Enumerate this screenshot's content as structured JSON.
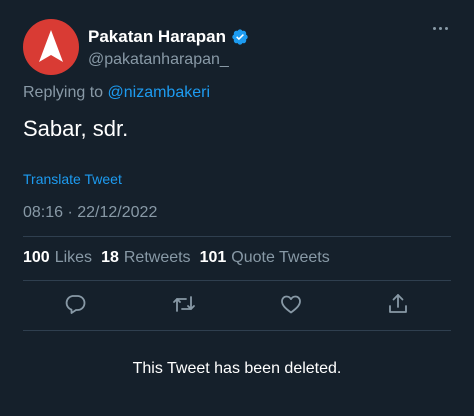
{
  "author": {
    "name": "Pakatan Harapan",
    "handle": "@pakatanharapan_",
    "avatar_icon": "ph-logo-icon",
    "avatar_color": "#d93b34"
  },
  "reply": {
    "prefix": "Replying to",
    "mention": "@nizambakeri"
  },
  "tweet": {
    "text": "Sabar, sdr.",
    "translate_label": "Translate Tweet",
    "timestamp": "08:16 · 22/12/2022"
  },
  "stats": {
    "likes_count": "100",
    "likes_label": "Likes",
    "retweets_count": "18",
    "retweets_label": "Retweets",
    "quotes_count": "101",
    "quotes_label": "Quote Tweets"
  },
  "actions": [
    "reply-icon",
    "retweet-icon",
    "like-icon",
    "share-icon"
  ],
  "notice": "This Tweet has been deleted.",
  "colors": {
    "background": "#15202b",
    "accent": "#1d9bf0",
    "muted": "#8899a6"
  }
}
